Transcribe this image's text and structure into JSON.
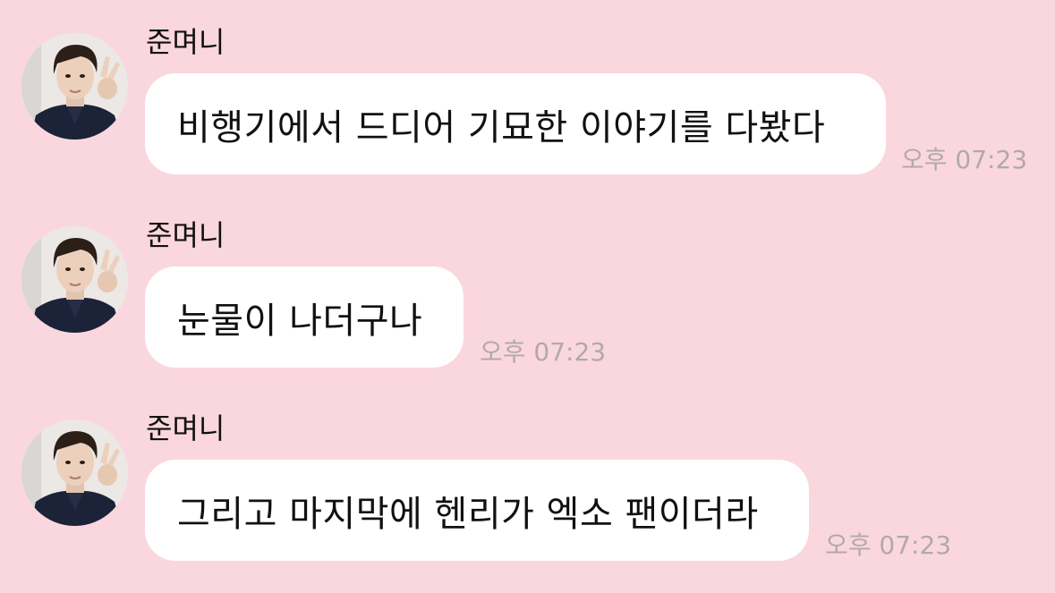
{
  "chat": {
    "background_color": "#fad7de",
    "bubble_color": "#ffffff",
    "messages": [
      {
        "sender": "준며니",
        "avatar_icon": "profile-photo",
        "text": "비행기에서 드디어 기묘한 이야기를 다봤다",
        "time": "오후 07:23"
      },
      {
        "sender": "준며니",
        "avatar_icon": "profile-photo",
        "text": "눈물이 나더구나",
        "time": "오후 07:23"
      },
      {
        "sender": "준며니",
        "avatar_icon": "profile-photo",
        "text": "그리고 마지막에 헨리가 엑소 팬이더라",
        "time": "오후 07:23"
      }
    ]
  }
}
